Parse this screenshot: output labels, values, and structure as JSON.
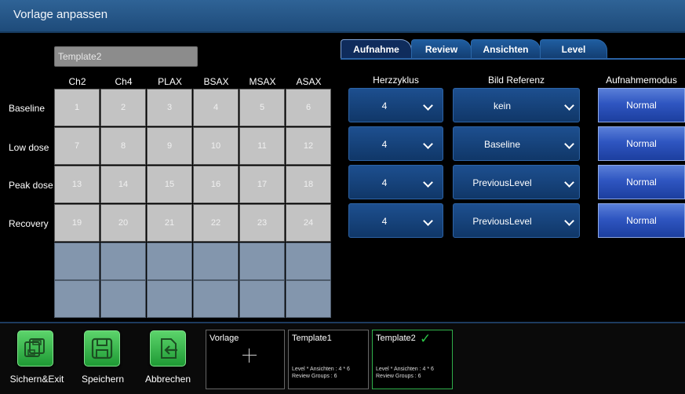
{
  "window": {
    "title": "Vorlage anpassen"
  },
  "template_name": "Template2",
  "grid": {
    "columns": [
      "Ch2",
      "Ch4",
      "PLAX",
      "BSAX",
      "MSAX",
      "ASAX"
    ],
    "rows": [
      {
        "label": "Baseline",
        "cells": [
          "1",
          "2",
          "3",
          "4",
          "5",
          "6"
        ]
      },
      {
        "label": "Low dose",
        "cells": [
          "7",
          "8",
          "9",
          "10",
          "11",
          "12"
        ]
      },
      {
        "label": "Peak dose",
        "cells": [
          "13",
          "14",
          "15",
          "16",
          "17",
          "18"
        ]
      },
      {
        "label": "Recovery",
        "cells": [
          "19",
          "20",
          "21",
          "22",
          "23",
          "24"
        ]
      }
    ]
  },
  "tabs": [
    {
      "label": "Aufnahme",
      "active": true
    },
    {
      "label": "Review",
      "active": false
    },
    {
      "label": "Ansichten",
      "active": false
    },
    {
      "label": "Level",
      "active": false
    }
  ],
  "acquisition": {
    "headers": {
      "heart_cycle": "Herzzyklus",
      "reference": "Bild Referenz",
      "mode": "Aufnahmemodus"
    },
    "rows": [
      {
        "heart_cycle": "4",
        "reference": "kein",
        "mode": "Normal"
      },
      {
        "heart_cycle": "4",
        "reference": "Baseline",
        "mode": "Normal"
      },
      {
        "heart_cycle": "4",
        "reference": "PreviousLevel",
        "mode": "Normal"
      },
      {
        "heart_cycle": "4",
        "reference": "PreviousLevel",
        "mode": "Normal"
      }
    ]
  },
  "actions": {
    "save_exit": "Sichern&Exit",
    "save": "Speichern",
    "cancel": "Abbrechen"
  },
  "templates": [
    {
      "title": "Vorlage",
      "line1": "",
      "line2": "",
      "selected": false,
      "is_new": true
    },
    {
      "title": "Template1",
      "line1": "Level * Ansichten  : 4 * 6",
      "line2": "Review Groups : 6",
      "selected": false,
      "is_new": false
    },
    {
      "title": "Template2",
      "line1": "Level * Ansichten  : 4 * 6",
      "line2": "Review Groups : 6",
      "selected": true,
      "is_new": false
    }
  ],
  "colors": {
    "accent": "#1e4b7a",
    "selected": "#2fae4a",
    "button_green": "#1e9a34"
  }
}
